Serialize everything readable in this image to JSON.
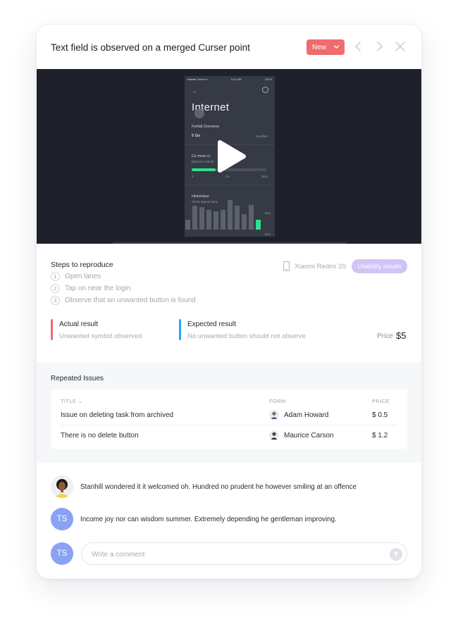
{
  "header": {
    "title": "Text field is observed on a merged Curser point",
    "status": "New",
    "icons": [
      "chevron-left-icon",
      "chevron-right-icon",
      "close-icon"
    ]
  },
  "video": {
    "phone": {
      "status_bar_left": "●●●●● Sketch ▾",
      "status_bar_center": "9:41 AM",
      "status_bar_right": "100%",
      "title": "Internet",
      "plan_label": "Forfait Données",
      "plan_value": "5 Go",
      "plan_action": "Modifier",
      "usage_label": "Ce mois-ci",
      "usage_sub": "Depuis le 18.03",
      "usage_fill": 0.32,
      "scale_min": "0",
      "scale_mid": "Go",
      "scale_max": "5Go",
      "history_label": "Historique",
      "history_sub": "Client depuis 2ans",
      "history_top": "4Go",
      "history_bottom": "2Go",
      "history_values": [
        14,
        34,
        32,
        28,
        26,
        28,
        42,
        34,
        22,
        35,
        14
      ],
      "history_highlight_index": 10
    },
    "play_icon": "play-icon"
  },
  "steps": {
    "title": "Steps to reproduce",
    "items": [
      {
        "num": "1",
        "label": "Open lanes"
      },
      {
        "num": "2",
        "label": "Tap on near the login"
      },
      {
        "num": "3",
        "label": "Observe that an unwanted button is found"
      }
    ]
  },
  "device": {
    "label": "Xiaomi Redmi 3S",
    "icon": "smartphone-icon"
  },
  "badge": {
    "label": "Usability issues",
    "color": "#cfc4f5"
  },
  "actual": {
    "heading": "Actual result",
    "text": "Unwanted symbol observed",
    "color": "#ef6c6c"
  },
  "expected": {
    "heading": "Expected result",
    "text": "No unwanted button should not observe",
    "color": "#2aa8f2"
  },
  "price": {
    "label": "Price",
    "value": "$5"
  },
  "repeated": {
    "title": "Repeated Issues",
    "columns": {
      "title": "TITLE",
      "form": "FORM",
      "price": "PRICE"
    },
    "rows": [
      {
        "title": "Issue on deleting task from archived",
        "person": "Adam Howard",
        "price": "$ 0.5"
      },
      {
        "title": "There is no delete button",
        "person": "Maurice Carson",
        "price": "$ 1.2"
      }
    ]
  },
  "comments": [
    {
      "initials": "",
      "text": "Stanhill wondered it it welcomed oh. Hundred no prudent he however smiling at an offence"
    },
    {
      "initials": "TS",
      "text": "Income joy nor can wisdom summer. Extremely depending he gentleman improving."
    }
  ],
  "composer": {
    "initials": "TS",
    "placeholder": "Write a comment"
  },
  "colors": {
    "accent_red": "#ef6c6c",
    "accent_blue": "#2aa8f2",
    "avatar_blue": "#8aa2f3",
    "green": "#2fe08f"
  }
}
